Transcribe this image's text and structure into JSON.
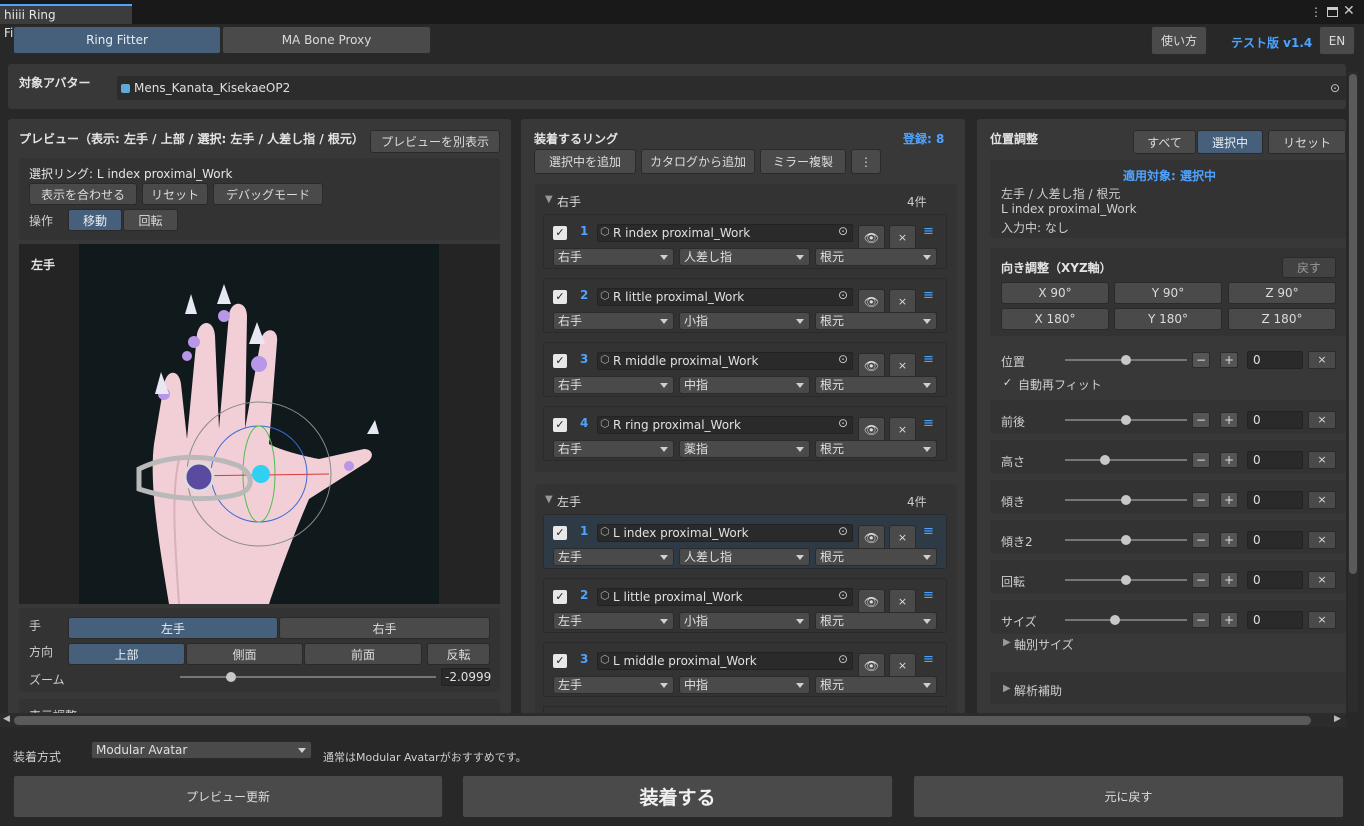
{
  "window": {
    "tab_title": "hiiii Ring Fitter_TEST*"
  },
  "header": {
    "tabs": [
      "Ring Fitter",
      "MA Bone Proxy"
    ],
    "help": "使い方",
    "version": "テスト版 v1.4",
    "lang": "EN"
  },
  "avatar": {
    "label": "対象アバター",
    "value": "Mens_Kanata_KisekaeOP2"
  },
  "preview": {
    "title": "プレビュー（表示: 左手 / 上部 / 選択: 左手 / 人差し指 / 根元）",
    "separate_button": "プレビューを別表示",
    "selected_ring": "選択リング: L index proximal_Work",
    "fit_button": "表示を合わせる",
    "reset_button": "リセット",
    "debug_button": "デバッグモード",
    "operation_label": "操作",
    "move": "移動",
    "rotate": "回転",
    "viewport_label": "左手",
    "hand_label": "手",
    "left_hand": "左手",
    "right_hand": "右手",
    "direction_label": "方向",
    "top": "上部",
    "side": "側面",
    "front": "前面",
    "flip": "反転",
    "zoom_label": "ズーム",
    "zoom_value": "-2.0999",
    "zoom_fraction": 0.2,
    "display_adjust": "表示調整"
  },
  "rings": {
    "title": "装着するリング",
    "count": "登録: 8",
    "add_selected": "選択中を追加",
    "add_catalog": "カタログから追加",
    "mirror": "ミラー複製",
    "more": "⋮",
    "right": {
      "label": "右手",
      "count": "4件",
      "items": [
        {
          "n": "1",
          "name": "R index proximal_Work",
          "hand": "右手",
          "finger": "人差し指",
          "seg": "根元"
        },
        {
          "n": "2",
          "name": "R little proximal_Work",
          "hand": "右手",
          "finger": "小指",
          "seg": "根元"
        },
        {
          "n": "3",
          "name": "R middle proximal_Work",
          "hand": "右手",
          "finger": "中指",
          "seg": "根元"
        },
        {
          "n": "4",
          "name": "R ring proximal_Work",
          "hand": "右手",
          "finger": "薬指",
          "seg": "根元"
        }
      ]
    },
    "left": {
      "label": "左手",
      "count": "4件",
      "items": [
        {
          "n": "1",
          "name": "L index proximal_Work",
          "hand": "左手",
          "finger": "人差し指",
          "seg": "根元"
        },
        {
          "n": "2",
          "name": "L little proximal_Work",
          "hand": "左手",
          "finger": "小指",
          "seg": "根元"
        },
        {
          "n": "3",
          "name": "L middle proximal_Work",
          "hand": "左手",
          "finger": "中指",
          "seg": "根元"
        }
      ]
    }
  },
  "position": {
    "title": "位置調整",
    "all": "すべて",
    "selected": "選択中",
    "reset": "リセット",
    "target": "適用対象: 選択中",
    "target_path": "左手 / 人差し指 / 根元",
    "target_ring": "L index proximal_Work",
    "input": "入力中: なし",
    "orient_title": "向き調整（XYZ軸）",
    "back": "戻す",
    "x90": "X 90°",
    "y90": "Y 90°",
    "z90": "Z 90°",
    "x180": "X 180°",
    "y180": "Y 180°",
    "z180": "Z 180°",
    "sliders": [
      {
        "label": "位置",
        "value": "0",
        "level": 0.5
      },
      {
        "label": "前後",
        "value": "0",
        "level": 0.5
      },
      {
        "label": "高さ",
        "value": "0",
        "level": 0.33
      },
      {
        "label": "傾き",
        "value": "0",
        "level": 0.5
      },
      {
        "label": "傾き2",
        "value": "0",
        "level": 0.5
      },
      {
        "label": "回転",
        "value": "0",
        "level": 0.5
      },
      {
        "label": "サイズ",
        "value": "0",
        "level": 0.41
      }
    ],
    "auto_refit": "自動再フィット",
    "axis_size": "軸別サイズ",
    "analysis": "解析補助"
  },
  "footer": {
    "mount_label": "装着方式",
    "mount_value": "Modular Avatar",
    "hint": "通常はModular Avatarがおすすめです。",
    "preview_update": "プレビュー更新",
    "mount": "装着する",
    "revert": "元に戻す"
  },
  "colors": {
    "accent": "#4ea3ff",
    "selected": "#46607c"
  }
}
